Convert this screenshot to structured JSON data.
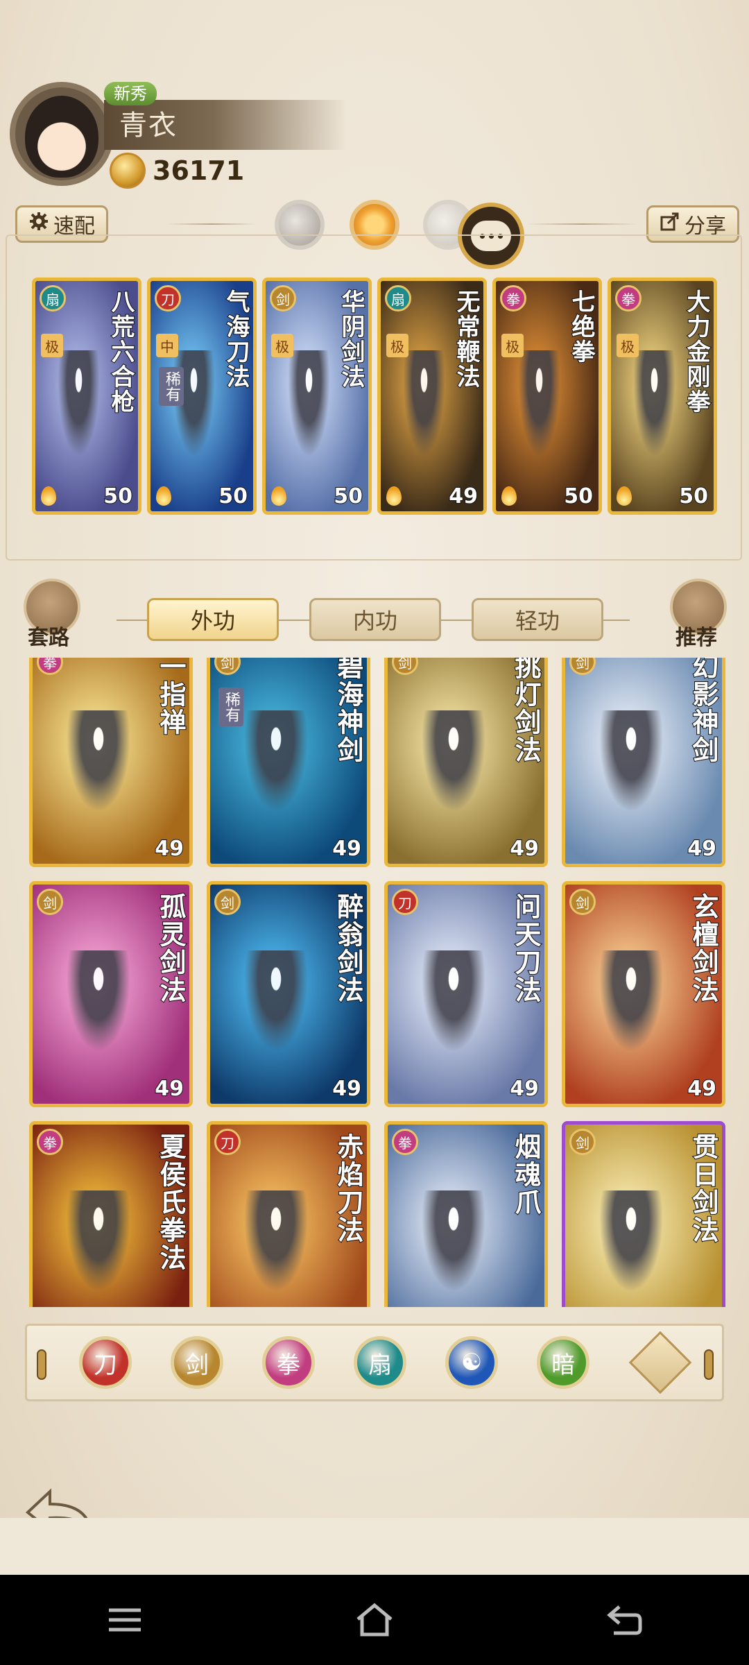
{
  "player": {
    "tag": "新秀",
    "name": "青衣",
    "currency": "36171"
  },
  "toolbar": {
    "quick_label": "速配",
    "share_label": "分享"
  },
  "equipped": [
    {
      "title": "八荒六合枪",
      "level": "50",
      "grade": "极",
      "rare": "",
      "type": "teal",
      "type_icon": "fan-icon"
    },
    {
      "title": "气海刀法",
      "level": "50",
      "grade": "中",
      "rare": "稀有",
      "type": "red",
      "type_icon": "blade-icon"
    },
    {
      "title": "华阴剑法",
      "level": "50",
      "grade": "极",
      "rare": "",
      "type": "gold",
      "type_icon": "sword-icon"
    },
    {
      "title": "无常鞭法",
      "level": "49",
      "grade": "极",
      "rare": "",
      "type": "teal",
      "type_icon": "fan-icon"
    },
    {
      "title": "七绝拳",
      "level": "50",
      "grade": "极",
      "rare": "",
      "type": "pink",
      "type_icon": "fist-icon"
    },
    {
      "title": "大力金刚拳",
      "level": "50",
      "grade": "极",
      "rare": "",
      "type": "pink",
      "type_icon": "fist-icon"
    }
  ],
  "tabs": [
    {
      "label": "外功",
      "active": true
    },
    {
      "label": "内功",
      "active": false
    },
    {
      "label": "轻功",
      "active": false
    }
  ],
  "side": {
    "left_label": "套路",
    "right_label": "推荐"
  },
  "skills": [
    {
      "title": "一指禅",
      "level": "49",
      "rare": "",
      "type": "pink",
      "border": "gold"
    },
    {
      "title": "碧海神剑",
      "level": "49",
      "rare": "稀有",
      "type": "gold",
      "border": "gold"
    },
    {
      "title": "挑灯剑法",
      "level": "49",
      "rare": "",
      "type": "gold",
      "border": "gold"
    },
    {
      "title": "幻影神剑",
      "level": "49",
      "rare": "",
      "type": "gold",
      "border": "gold"
    },
    {
      "title": "孤灵剑法",
      "level": "49",
      "rare": "",
      "type": "gold",
      "border": "gold"
    },
    {
      "title": "醉翁剑法",
      "level": "49",
      "rare": "",
      "type": "gold",
      "border": "gold"
    },
    {
      "title": "问天刀法",
      "level": "49",
      "rare": "",
      "type": "red",
      "border": "gold"
    },
    {
      "title": "玄檀剑法",
      "level": "49",
      "rare": "",
      "type": "gold",
      "border": "gold"
    },
    {
      "title": "夏侯氏拳法",
      "level": "",
      "rare": "",
      "type": "pink",
      "border": "gold"
    },
    {
      "title": "赤焰刀法",
      "level": "",
      "rare": "",
      "type": "red",
      "border": "gold"
    },
    {
      "title": "烟魂爪",
      "level": "",
      "rare": "",
      "type": "pink",
      "border": "gold"
    },
    {
      "title": "贯日剑法",
      "level": "",
      "rare": "",
      "type": "gold",
      "border": "purple"
    }
  ],
  "filters": [
    {
      "name": "blade-filter-icon",
      "color": "#c0322a"
    },
    {
      "name": "sword-filter-icon",
      "color": "#b7862e"
    },
    {
      "name": "fist-filter-icon",
      "color": "#c23d80"
    },
    {
      "name": "fan-filter-icon",
      "color": "#1e8a8a"
    },
    {
      "name": "taiji-filter-icon",
      "color": "#1f57b8"
    },
    {
      "name": "hidden-weapon-filter-icon",
      "color": "#4e9a2a"
    }
  ],
  "footer": {
    "back_label": "返回"
  },
  "colors": {
    "red": "#c0322a",
    "gold": "#b7862e",
    "pink": "#c23d80",
    "teal": "#1e8a8a"
  }
}
